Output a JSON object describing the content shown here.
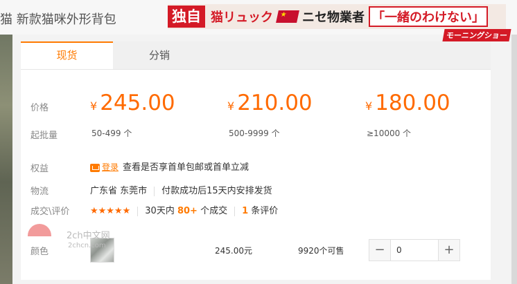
{
  "header": {
    "product_title": "猫 新款猫咪外形背包"
  },
  "news_banner": {
    "tag": "独自",
    "headline_part1": "猫リュック",
    "headline_part2": "ニセ物業者",
    "headline_quote": "「一緒のわけない」",
    "show_name": "モーニングショー"
  },
  "tabs": [
    {
      "label": "现货",
      "active": true
    },
    {
      "label": "分销",
      "active": false
    }
  ],
  "labels": {
    "price": "价格",
    "moq": "起批量",
    "rights": "权益",
    "logistics": "物流",
    "deals": "成交\\评价",
    "variant": "颜色"
  },
  "price_tiers": [
    {
      "currency": "¥",
      "price": "245.00",
      "qty": "50-499 个"
    },
    {
      "currency": "¥",
      "price": "210.00",
      "qty": "500-9999 个"
    },
    {
      "currency": "¥",
      "price": "180.00",
      "qty": "≥10000 个"
    }
  ],
  "rights": {
    "badge": "登录",
    "text": "查看是否享首单包邮或首单立减"
  },
  "logistics": {
    "origin": "广东省 东莞市",
    "shipping": "付款成功后15天内安排发货"
  },
  "deals": {
    "stars": "★★★★★",
    "rating": 5,
    "prefix": "30天内",
    "count": "80+",
    "suffix": "个成交",
    "review_count": "1",
    "review_suffix": "条评价"
  },
  "variant_row": {
    "price": "245.00元",
    "stock": "9920个可售",
    "minus": "−",
    "quantity": "0",
    "plus": "+"
  },
  "watermark": {
    "line1": "2ch中文网",
    "line2": "2chcn.com"
  },
  "colors": {
    "accent": "#ff6a00",
    "news_red": "#d41a26"
  }
}
